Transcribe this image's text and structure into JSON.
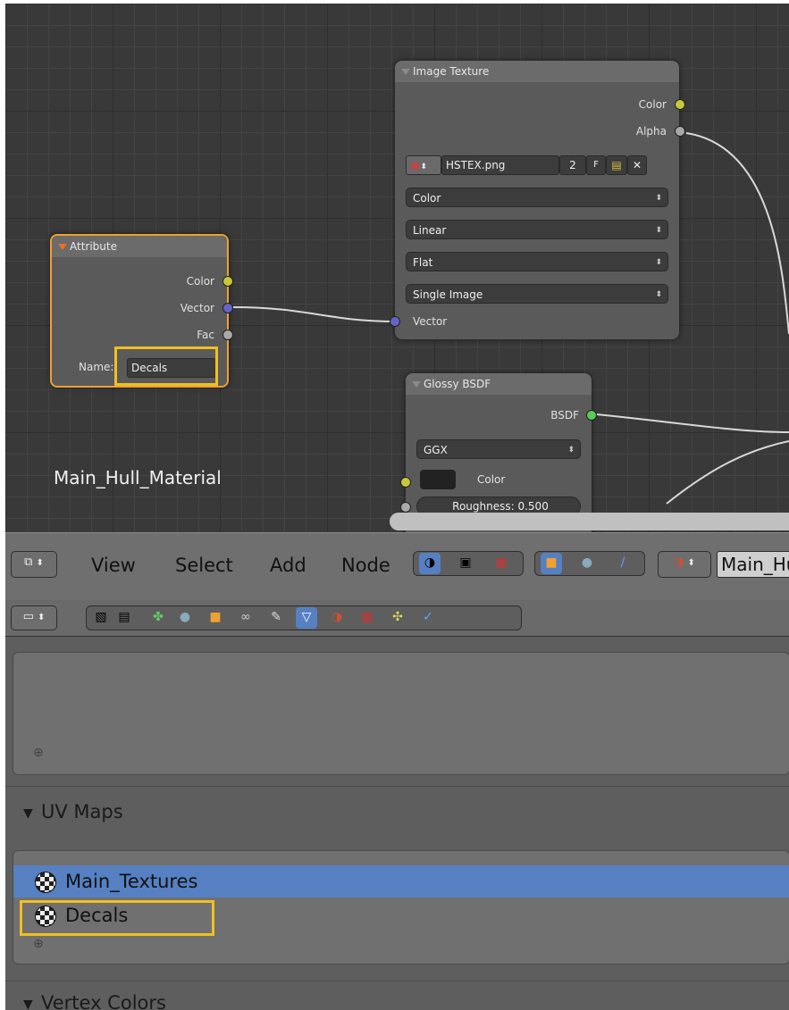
{
  "node_editor": {
    "material_name": "Main_Hull_Material",
    "attribute_node": {
      "title": "Attribute",
      "outputs": [
        "Color",
        "Vector",
        "Fac"
      ],
      "name_label": "Name:",
      "name_value": "Decals"
    },
    "image_texture_node": {
      "title": "Image Texture",
      "outputs": [
        "Color",
        "Alpha"
      ],
      "image_name": "HSTEX.png",
      "users": "2",
      "fake_user": "F",
      "color_space": "Color",
      "interpolation": "Linear",
      "projection": "Flat",
      "source": "Single Image",
      "input": "Vector"
    },
    "glossy_node": {
      "title": "Glossy BSDF",
      "output": "BSDF",
      "distribution": "GGX",
      "color_label": "Color",
      "roughness": "Roughness: 0.500"
    },
    "socket_colors": {
      "color": "#c8c83a",
      "float": "#a8a8a8",
      "vector": "#6464c8",
      "shader": "#5ac85a"
    }
  },
  "header": {
    "menus": [
      "View",
      "Select",
      "Add",
      "Node"
    ],
    "material_field": "Main_Hull_Material"
  },
  "properties": {
    "uv_maps": {
      "title": "UV Maps",
      "items": [
        {
          "label": "Main_Textures",
          "selected": true
        },
        {
          "label": "Decals",
          "selected": false
        }
      ]
    },
    "vertex_colors": {
      "title": "Vertex Colors"
    }
  },
  "colors": {
    "highlight": "#f0c020",
    "selection": "#5680c2",
    "accent_orange": "#f0a030"
  }
}
